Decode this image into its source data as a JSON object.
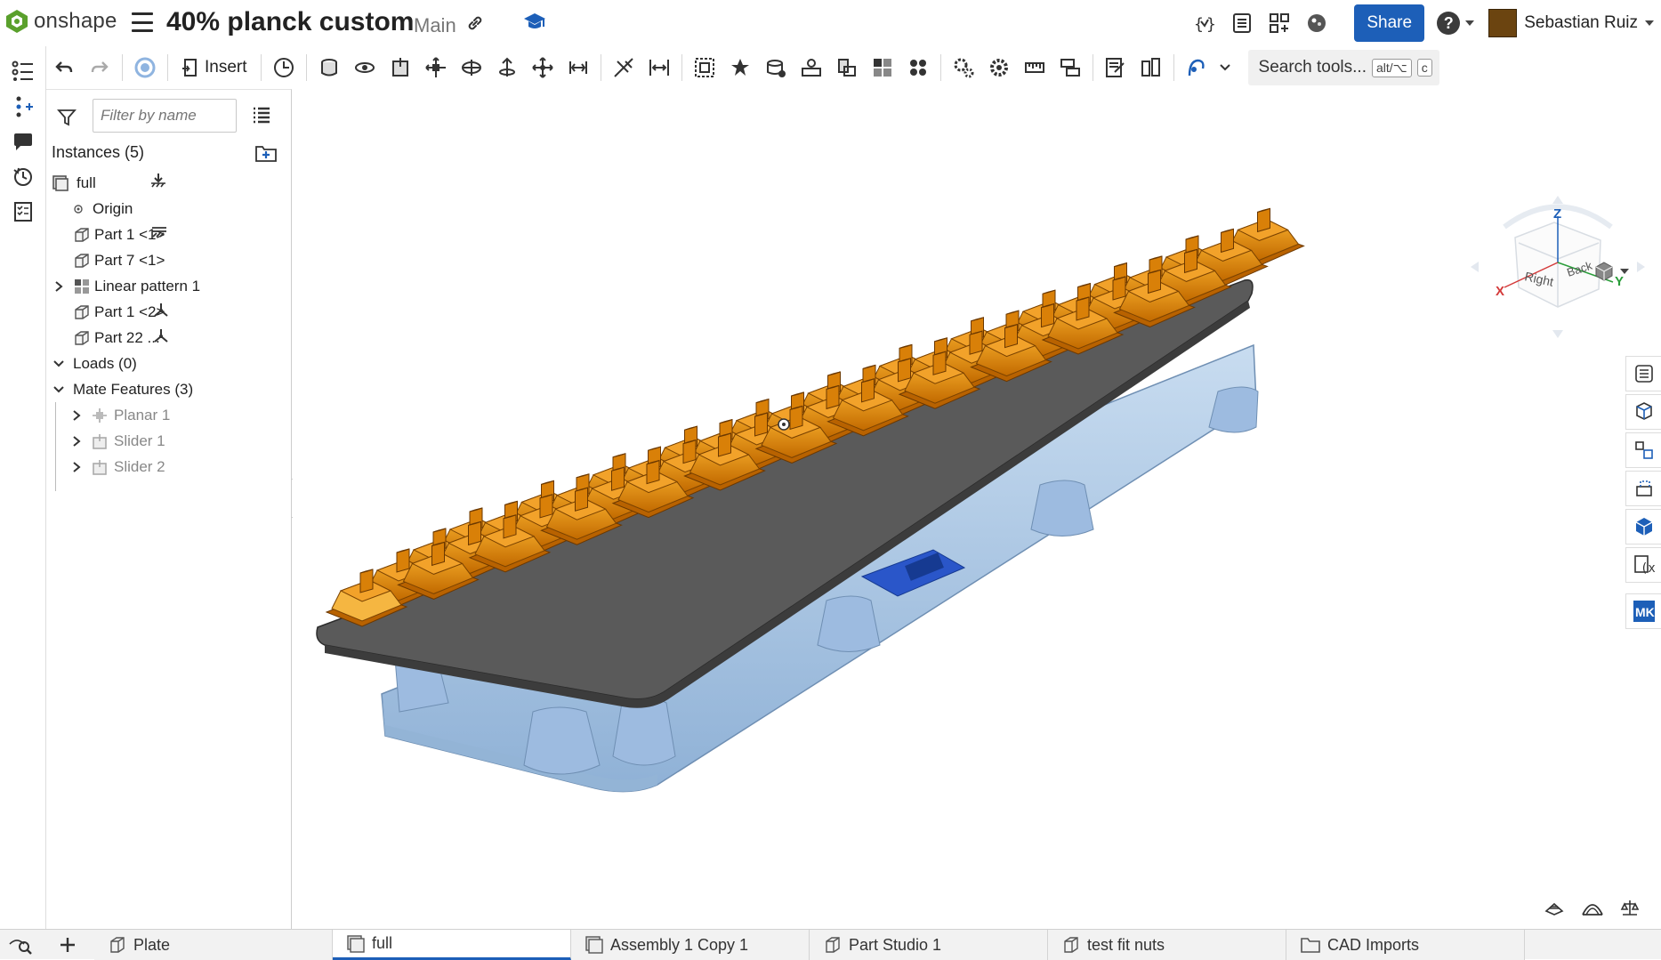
{
  "app": {
    "brand": "onshape",
    "document_title": "40% planck custom",
    "branch": "Main",
    "share_label": "Share",
    "user_name": "Sebastian Ruiz"
  },
  "toolbar": {
    "insert_label": "Insert",
    "search_label": "Search tools...",
    "search_shortcut_1": "alt/⌥",
    "search_shortcut_2": "c"
  },
  "panel": {
    "filter_placeholder": "Filter by name",
    "instances_header": "Instances (5)",
    "tree": [
      {
        "label": "full",
        "icon": "assembly-icon"
      },
      {
        "label": "Origin",
        "icon": "origin-icon"
      },
      {
        "label": "Part 1 <1>",
        "icon": "part-icon"
      },
      {
        "label": "Part 7 <1>",
        "icon": "part-icon"
      },
      {
        "label": "Linear pattern 1",
        "icon": "pattern-icon"
      },
      {
        "label": "Part 1 <2>",
        "icon": "part-icon"
      },
      {
        "label": "Part 22 ...",
        "icon": "part-icon"
      },
      {
        "label": "Loads (0)",
        "icon": "chevron-down-icon"
      },
      {
        "label": "Mate Features (3)",
        "icon": "chevron-down-icon"
      },
      {
        "label": "Planar 1",
        "icon": "planar-mate-icon"
      },
      {
        "label": "Slider 1",
        "icon": "slider-mate-icon"
      },
      {
        "label": "Slider 2",
        "icon": "slider-mate-icon"
      }
    ]
  },
  "view_cube": {
    "faces": [
      "Right",
      "Back"
    ],
    "axes": [
      "Z",
      "X",
      "Y"
    ]
  },
  "tabs": [
    {
      "label": "Plate",
      "icon": "part-studio-icon",
      "active": false
    },
    {
      "label": "full",
      "icon": "assembly-icon",
      "active": true
    },
    {
      "label": "Assembly 1 Copy 1",
      "icon": "assembly-icon",
      "active": false
    },
    {
      "label": "Part Studio 1",
      "icon": "part-studio-icon",
      "active": false
    },
    {
      "label": "test fit nuts",
      "icon": "part-studio-icon",
      "active": false
    },
    {
      "label": "CAD Imports",
      "icon": "folder-icon",
      "active": false
    }
  ],
  "colors": {
    "accent": "#1d5fb8",
    "keycap_orange": "#e8900a",
    "plate_dark": "#5a5a5a",
    "case_blue": "#a9c9e8",
    "pcb_blue": "#2a56c9"
  }
}
